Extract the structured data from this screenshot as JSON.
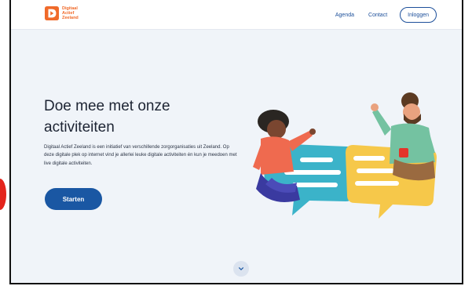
{
  "header": {
    "logo_lines": [
      "Digitaal",
      "Actief",
      "Zeeland"
    ],
    "nav": {
      "agenda": "Agenda",
      "contact": "Contact",
      "login": "Inloggen"
    }
  },
  "hero": {
    "title": "Doe mee met onze activiteiten",
    "description": "Digitaal Actief Zeeland is een initiatief van verschillende zorgorganisaties uit Zeeland. Op deze digitale plek op internet vind je allerlei leuke digitale activiteiten én kun je meedoen met live digitale activiteiten.",
    "cta": "Starten"
  },
  "icons": {
    "logo": "digitaal-actief-logo-icon",
    "scroll": "chevron-down-icon"
  },
  "colors": {
    "brand_orange": "#f06a2a",
    "brand_blue": "#1a57a3",
    "background": "#f0f4f9"
  }
}
